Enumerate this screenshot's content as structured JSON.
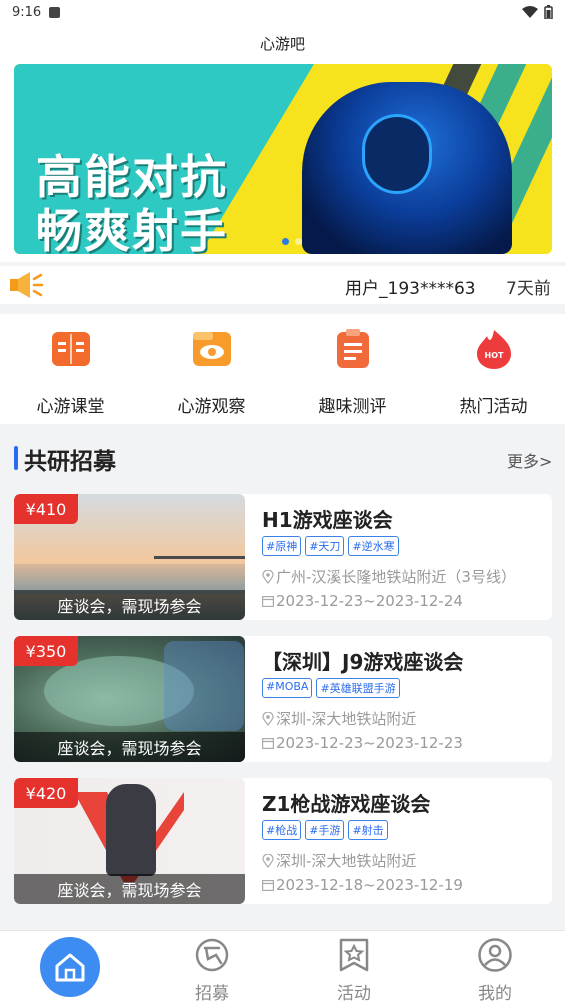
{
  "status": {
    "time": "9:16"
  },
  "header": {
    "title": "心游吧"
  },
  "banner": {
    "line1": "高能对抗",
    "line2": "畅爽射手"
  },
  "notice": {
    "message": "用户_193****63",
    "ago": "7天前"
  },
  "quick": [
    {
      "label": "心游课堂",
      "icon": "book-icon",
      "color": "#f26b2c"
    },
    {
      "label": "心游观察",
      "icon": "eye-folder-icon",
      "color": "#f79b2a"
    },
    {
      "label": "趣味测评",
      "icon": "clipboard-icon",
      "color": "#f06a3a"
    },
    {
      "label": "热门活动",
      "icon": "hot-fire-icon",
      "color": "#ee3b3b"
    }
  ],
  "section": {
    "title": "共研招募",
    "more": "更多>"
  },
  "cards": [
    {
      "price": "¥410",
      "caption": "座谈会，需现场参会",
      "name": "H1游戏座谈会",
      "tags": [
        "#原神",
        "#天刀",
        "#逆水寒"
      ],
      "location": "广州-汉溪长隆地铁站附近（3号线）",
      "date": "2023-12-23~2023-12-24"
    },
    {
      "price": "¥350",
      "caption": "座谈会，需现场参会",
      "name": "【深圳】J9游戏座谈会",
      "tags": [
        "#MOBA",
        "#英雄联盟手游"
      ],
      "location": "深圳-深大地铁站附近",
      "date": "2023-12-23~2023-12-23"
    },
    {
      "price": "¥420",
      "caption": "座谈会，需现场参会",
      "name": "Z1枪战游戏座谈会",
      "tags": [
        "#枪战",
        "#手游",
        "#射击"
      ],
      "location": "深圳-深大地铁站附近",
      "date": "2023-12-18~2023-12-19"
    }
  ],
  "nav": [
    {
      "label": "",
      "icon": "home-icon"
    },
    {
      "label": "招募",
      "icon": "recruit-icon"
    },
    {
      "label": "活动",
      "icon": "activity-icon"
    },
    {
      "label": "我的",
      "icon": "profile-icon"
    }
  ],
  "colors": {
    "accent": "#3d8cf2",
    "price": "#e5322d",
    "tag": "#2a6cf0"
  }
}
